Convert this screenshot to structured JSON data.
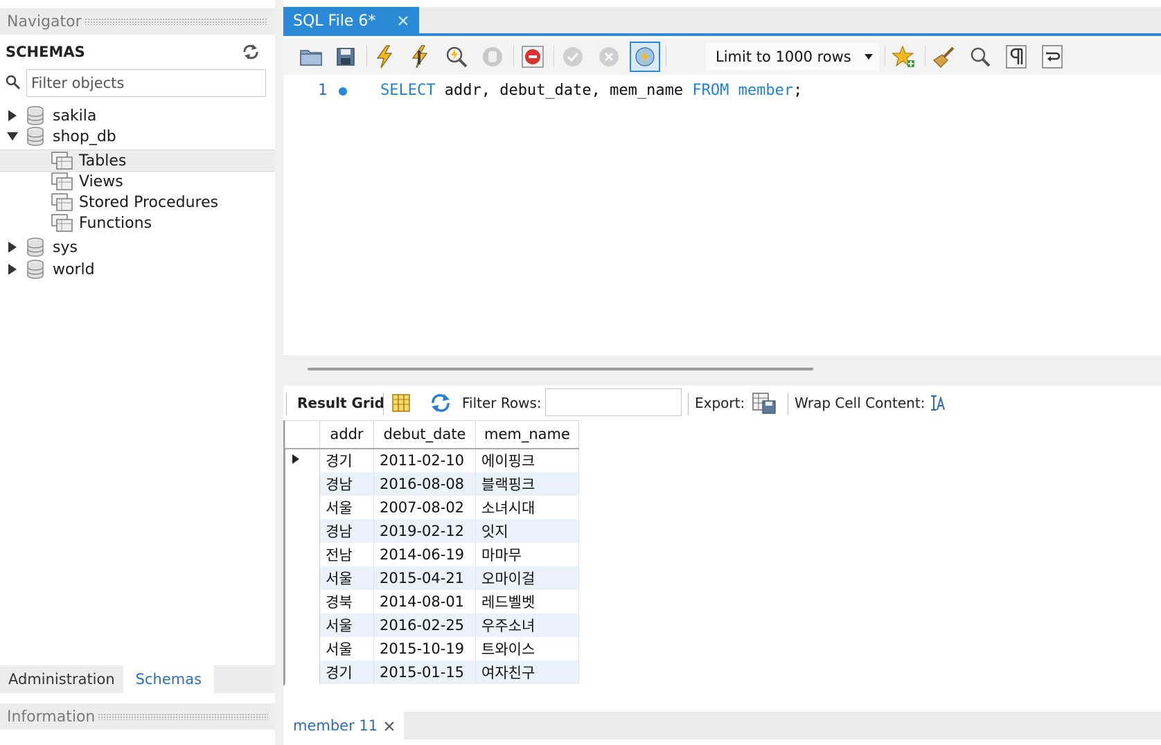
{
  "navigator": {
    "title": "Navigator",
    "schemas_label": "SCHEMAS",
    "filter_placeholder": "Filter objects",
    "tree": {
      "sakila": "sakila",
      "shop_db": "shop_db",
      "tables": "Tables",
      "views": "Views",
      "stored_procedures": "Stored Procedures",
      "functions": "Functions",
      "sys": "sys",
      "world": "world"
    },
    "bottom_tabs": {
      "administration": "Administration",
      "schemas": "Schemas"
    },
    "information_title": "Information"
  },
  "editor": {
    "tab_label": "SQL File 6*",
    "limit_label": "Limit to 1000 rows",
    "line_number": "1",
    "code": {
      "select": "SELECT",
      "cols": " addr, debut_date, mem_name ",
      "from": "FROM",
      "space": " ",
      "table": "member",
      "semi": ";"
    }
  },
  "result": {
    "result_grid_label": "Result Grid",
    "filter_rows_label": "Filter Rows:",
    "export_label": "Export:",
    "wrap_label": "Wrap Cell Content:",
    "columns": [
      "addr",
      "debut_date",
      "mem_name"
    ],
    "rows": [
      [
        "경기",
        "2011-02-10",
        "에이핑크"
      ],
      [
        "경남",
        "2016-08-08",
        "블랙핑크"
      ],
      [
        "서울",
        "2007-08-02",
        "소녀시대"
      ],
      [
        "경남",
        "2019-02-12",
        "잇지"
      ],
      [
        "전남",
        "2014-06-19",
        "마마무"
      ],
      [
        "서울",
        "2015-04-21",
        "오마이걸"
      ],
      [
        "경북",
        "2014-08-01",
        "레드벨벳"
      ],
      [
        "서울",
        "2016-02-25",
        "우주소녀"
      ],
      [
        "서울",
        "2015-10-19",
        "트와이스"
      ],
      [
        "경기",
        "2015-01-15",
        "여자친구"
      ]
    ],
    "result_tab_label": "member 11"
  },
  "colors": {
    "accent": "#2a8ad8",
    "keyword": "#1f82d8",
    "link": "#2a6ebb",
    "alt_row": "#eaf3fb"
  }
}
